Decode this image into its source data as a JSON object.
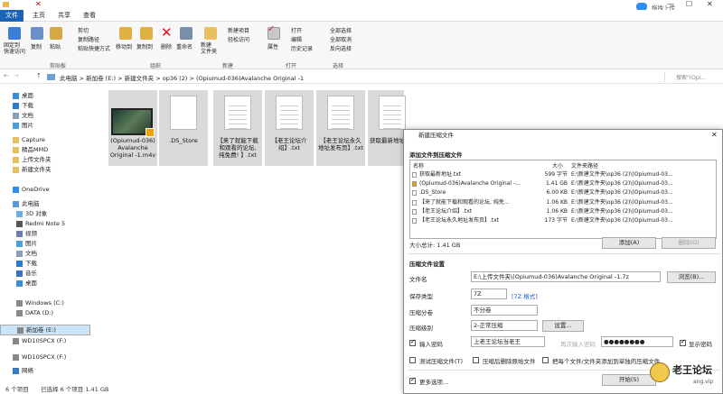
{
  "titlebar": {
    "upload_label": "拖拽上传"
  },
  "tabs": [
    "文件",
    "主页",
    "共享",
    "查看"
  ],
  "ribbon": {
    "pin_label": "固定到\n快速访问",
    "copy": "复制",
    "paste": "粘贴",
    "cut": "剪切",
    "copy_path": "复制路径",
    "paste_shortcut": "粘贴快捷方式",
    "move_to": "移动到",
    "copy_to": "复制到",
    "delete": "删除",
    "rename": "重命名",
    "new_folder": "新建\n文件夹",
    "new_item": "新建项目",
    "easy_access": "轻松访问",
    "properties": "属性",
    "open": "打开",
    "edit": "编辑",
    "history": "历史记录",
    "select_all": "全部选择",
    "select_none": "全部取消",
    "invert": "反向选择",
    "groups": [
      "剪贴板",
      "组织",
      "新建",
      "打开",
      "选择"
    ]
  },
  "address": {
    "crumbs": [
      "此电脑",
      "新加卷 (E:)",
      "新建文件夹",
      "op36 (2)",
      "(Opiumud-036)Avalanche Original -1"
    ],
    "search_placeholder": "搜索\"(Opi..."
  },
  "sidebar": [
    {
      "label": "桌面",
      "icon": "desktop-icon"
    },
    {
      "label": "下载",
      "icon": "download-icon"
    },
    {
      "label": "文档",
      "icon": "document-icon"
    },
    {
      "label": "图片",
      "icon": "picture-icon"
    },
    {
      "label": "Capture",
      "icon": "folder-icon"
    },
    {
      "label": "精品MMD",
      "icon": "folder-icon"
    },
    {
      "label": "上传文件夹",
      "icon": "folder-icon"
    },
    {
      "label": "新建文件夹",
      "icon": "folder-icon"
    },
    {
      "label": "OneDrive",
      "icon": "cloud-icon"
    },
    {
      "label": "此电脑",
      "icon": "computer-icon"
    },
    {
      "label": "3D 对象",
      "icon": "cube-icon"
    },
    {
      "label": "Redmi Note 5",
      "icon": "phone-icon"
    },
    {
      "label": "视频",
      "icon": "video-icon"
    },
    {
      "label": "图片",
      "icon": "picture-icon"
    },
    {
      "label": "文档",
      "icon": "document-icon"
    },
    {
      "label": "下载",
      "icon": "download-icon"
    },
    {
      "label": "音乐",
      "icon": "music-icon"
    },
    {
      "label": "桌面",
      "icon": "desktop-icon"
    },
    {
      "label": "Windows (C:)",
      "icon": "drive-icon"
    },
    {
      "label": "DATA (D:)",
      "icon": "drive-icon"
    },
    {
      "label": "新加卷 (E:)",
      "icon": "drive-icon"
    },
    {
      "label": "WD10SPCX (F:)",
      "icon": "drive-icon"
    },
    {
      "label": "WD10SPCX (F:)",
      "icon": "drive-icon"
    },
    {
      "label": "网络",
      "icon": "network-icon"
    }
  ],
  "files": [
    {
      "name": "(Opiumud-036)\nAvalanche\nOriginal -1.m4v",
      "type": "video"
    },
    {
      "name": ".DS_Store",
      "type": "blank"
    },
    {
      "name": "【来了就能下载\n和观看的论坛,\n纯免费! 】.txt",
      "type": "text"
    },
    {
      "name": "【老王论坛介\n绍】.txt",
      "type": "text"
    },
    {
      "name": "【老王论坛永久\n地址发布页】.txt",
      "type": "text"
    },
    {
      "name": "获取最新地址",
      "type": "text"
    }
  ],
  "status": {
    "count": "6 个项目",
    "selected": "已选择 6 个项目  1.41 GB"
  },
  "dialog": {
    "title": "新建压缩文件",
    "section1": "添加文件到压缩文件",
    "col_name": "名称",
    "col_size": "大小",
    "col_path": "文件夹路径",
    "rows": [
      {
        "name": "获取最新地址.txt",
        "size": "599 字节",
        "path": "E:\\新建文件夹\\op36 (2)\\(Opiumud-03..."
      },
      {
        "name": "(Opiumud-036)Avalanche Original -...",
        "size": "1.41 GB",
        "path": "E:\\新建文件夹\\op36 (2)\\(Opiumud-03..."
      },
      {
        "name": ".DS_Store",
        "size": "6.00 KB",
        "path": "E:\\新建文件夹\\op36 (2)\\(Opiumud-03..."
      },
      {
        "name": "【来了就能下载和观看的论坛, 纯免...",
        "size": "1.06 KB",
        "path": "E:\\新建文件夹\\op36 (2)\\(Opiumud-03..."
      },
      {
        "name": "【老王论坛介绍】.txt",
        "size": "1.06 KB",
        "path": "E:\\新建文件夹\\op36 (2)\\(Opiumud-03..."
      },
      {
        "name": "【老王论坛永久地址发布页】.txt",
        "size": "173 字节",
        "path": "E:\\新建文件夹\\op36 (2)\\(Opiumud-03..."
      }
    ],
    "total": "大小总计: 1.41 GB",
    "add_btn": "添加(A)",
    "remove_btn": "删除(D)",
    "section2": "压缩文件设置",
    "filename_label": "文件名",
    "filename_value": "E:\\上传文件夹\\(Opiumud-036)Avalanche Original -1.7z",
    "browse_btn": "浏览(B)...",
    "format_label": "保存类型",
    "format_value": "7Z",
    "format_link": "[7Z 格式]",
    "split_label": "压缩分卷",
    "split_value": "不分卷",
    "level_label": "压缩级别",
    "level_value": "2-正常压缩",
    "settings_btn": "设置...",
    "pwd_label": "输入密码",
    "pwd_value": "上老王论坛当老王",
    "pwd2_placeholder": "再次输入密码",
    "pwd2_value": "●●●●●●●●",
    "show_pwd": "显示密码",
    "opt1": "测试压缩文件(T)",
    "opt2": "压缩后删除原始文件",
    "opt3": "把每个文件/文件夹添加到单独的压缩文件",
    "more": "更多选项...",
    "start_btn": "开始(S)",
    "watermark": "老王论坛",
    "watermark_sub": "ang.vip"
  }
}
